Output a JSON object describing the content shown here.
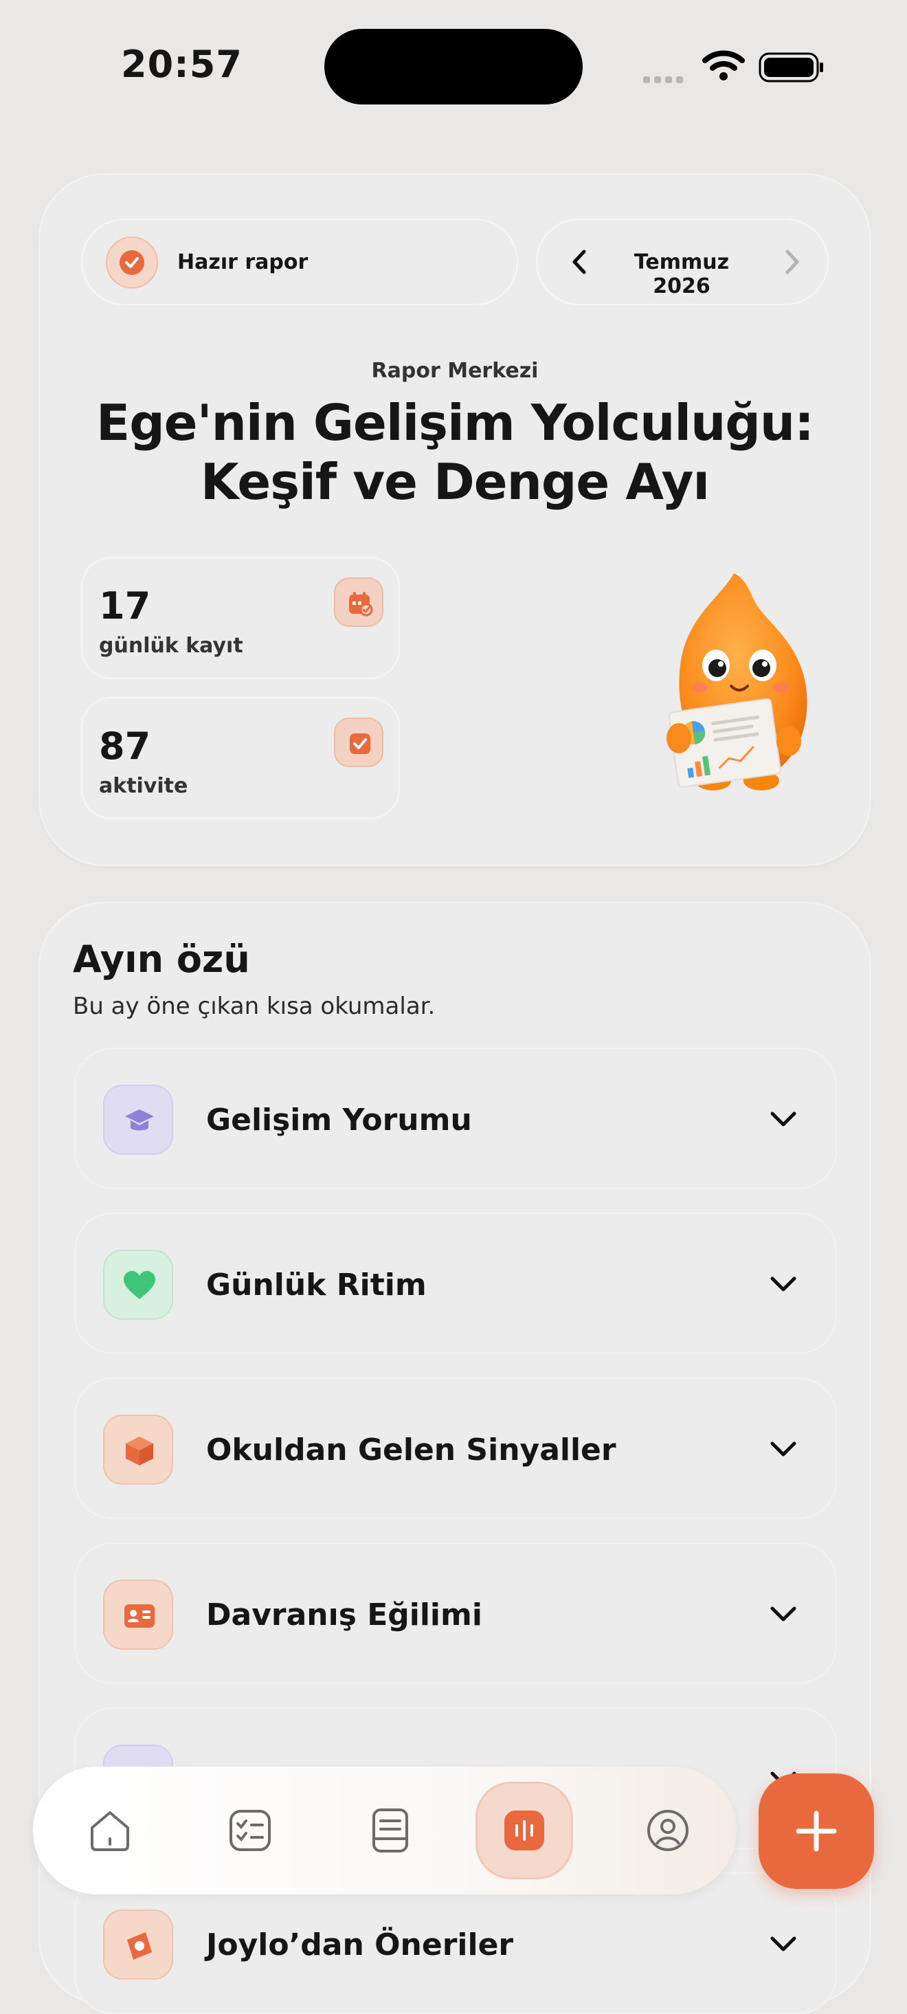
{
  "status_bar": {
    "time": "20:57"
  },
  "hero": {
    "ready_label": "Hazır rapor",
    "month_label": "Temmuz 2026",
    "eyebrow": "Rapor Merkezi",
    "title_line1": "Ege'nin Gelişim Yolculuğu:",
    "title_line2": "Keşif ve Denge Ayı",
    "stats": [
      {
        "value": "17",
        "label": "günlük kayıt",
        "icon": "calendar-icon"
      },
      {
        "value": "87",
        "label": "aktivite",
        "icon": "checkbox-icon"
      }
    ]
  },
  "summary": {
    "title": "Ayın özü",
    "subtitle": "Bu ay öne çıkan kısa okumalar.",
    "items": [
      {
        "label": "Gelişim Yorumu",
        "icon": "graduation-cap-icon",
        "color": "#8c83d6"
      },
      {
        "label": "Günlük Ritim",
        "icon": "heart-icon",
        "color": "#3ec57a"
      },
      {
        "label": "Okuldan Gelen Sinyaller",
        "icon": "box-icon",
        "color": "#e8693e"
      },
      {
        "label": "Davranış Eğilimi",
        "icon": "id-card-icon",
        "color": "#e8693e"
      },
      {
        "label": "",
        "icon": "list-icon",
        "color": "#8c83d6"
      },
      {
        "label": "Joylo’dan Öneriler",
        "icon": "compass-icon",
        "color": "#e8693e"
      }
    ]
  },
  "tabbar": {
    "tabs": [
      "home-icon",
      "checklist-icon",
      "journal-icon",
      "reports-icon",
      "profile-icon"
    ],
    "active": "reports-icon"
  },
  "colors": {
    "accent": "#e8693e",
    "background": "#e9e8e7",
    "card": "#edecec"
  }
}
